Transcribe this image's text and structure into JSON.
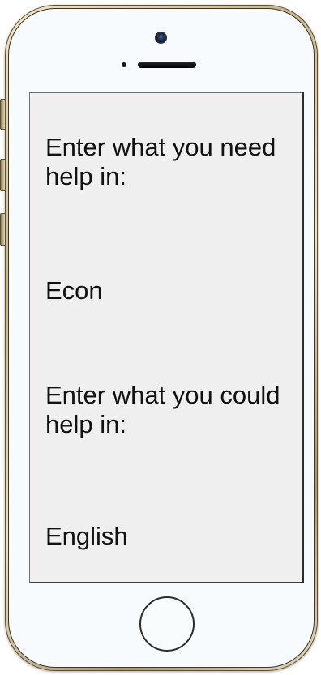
{
  "screen": {
    "need_prompt": "Enter what you need help in:",
    "need_value": "Econ",
    "could_prompt": "Enter what you could help in:",
    "could_value": "English"
  },
  "device": {
    "frame_color": "#c9b68a",
    "face_color": "#f7fbfd",
    "screen_color": "#efefef",
    "camera_icon": "camera-icon",
    "home_icon": "home-button"
  }
}
